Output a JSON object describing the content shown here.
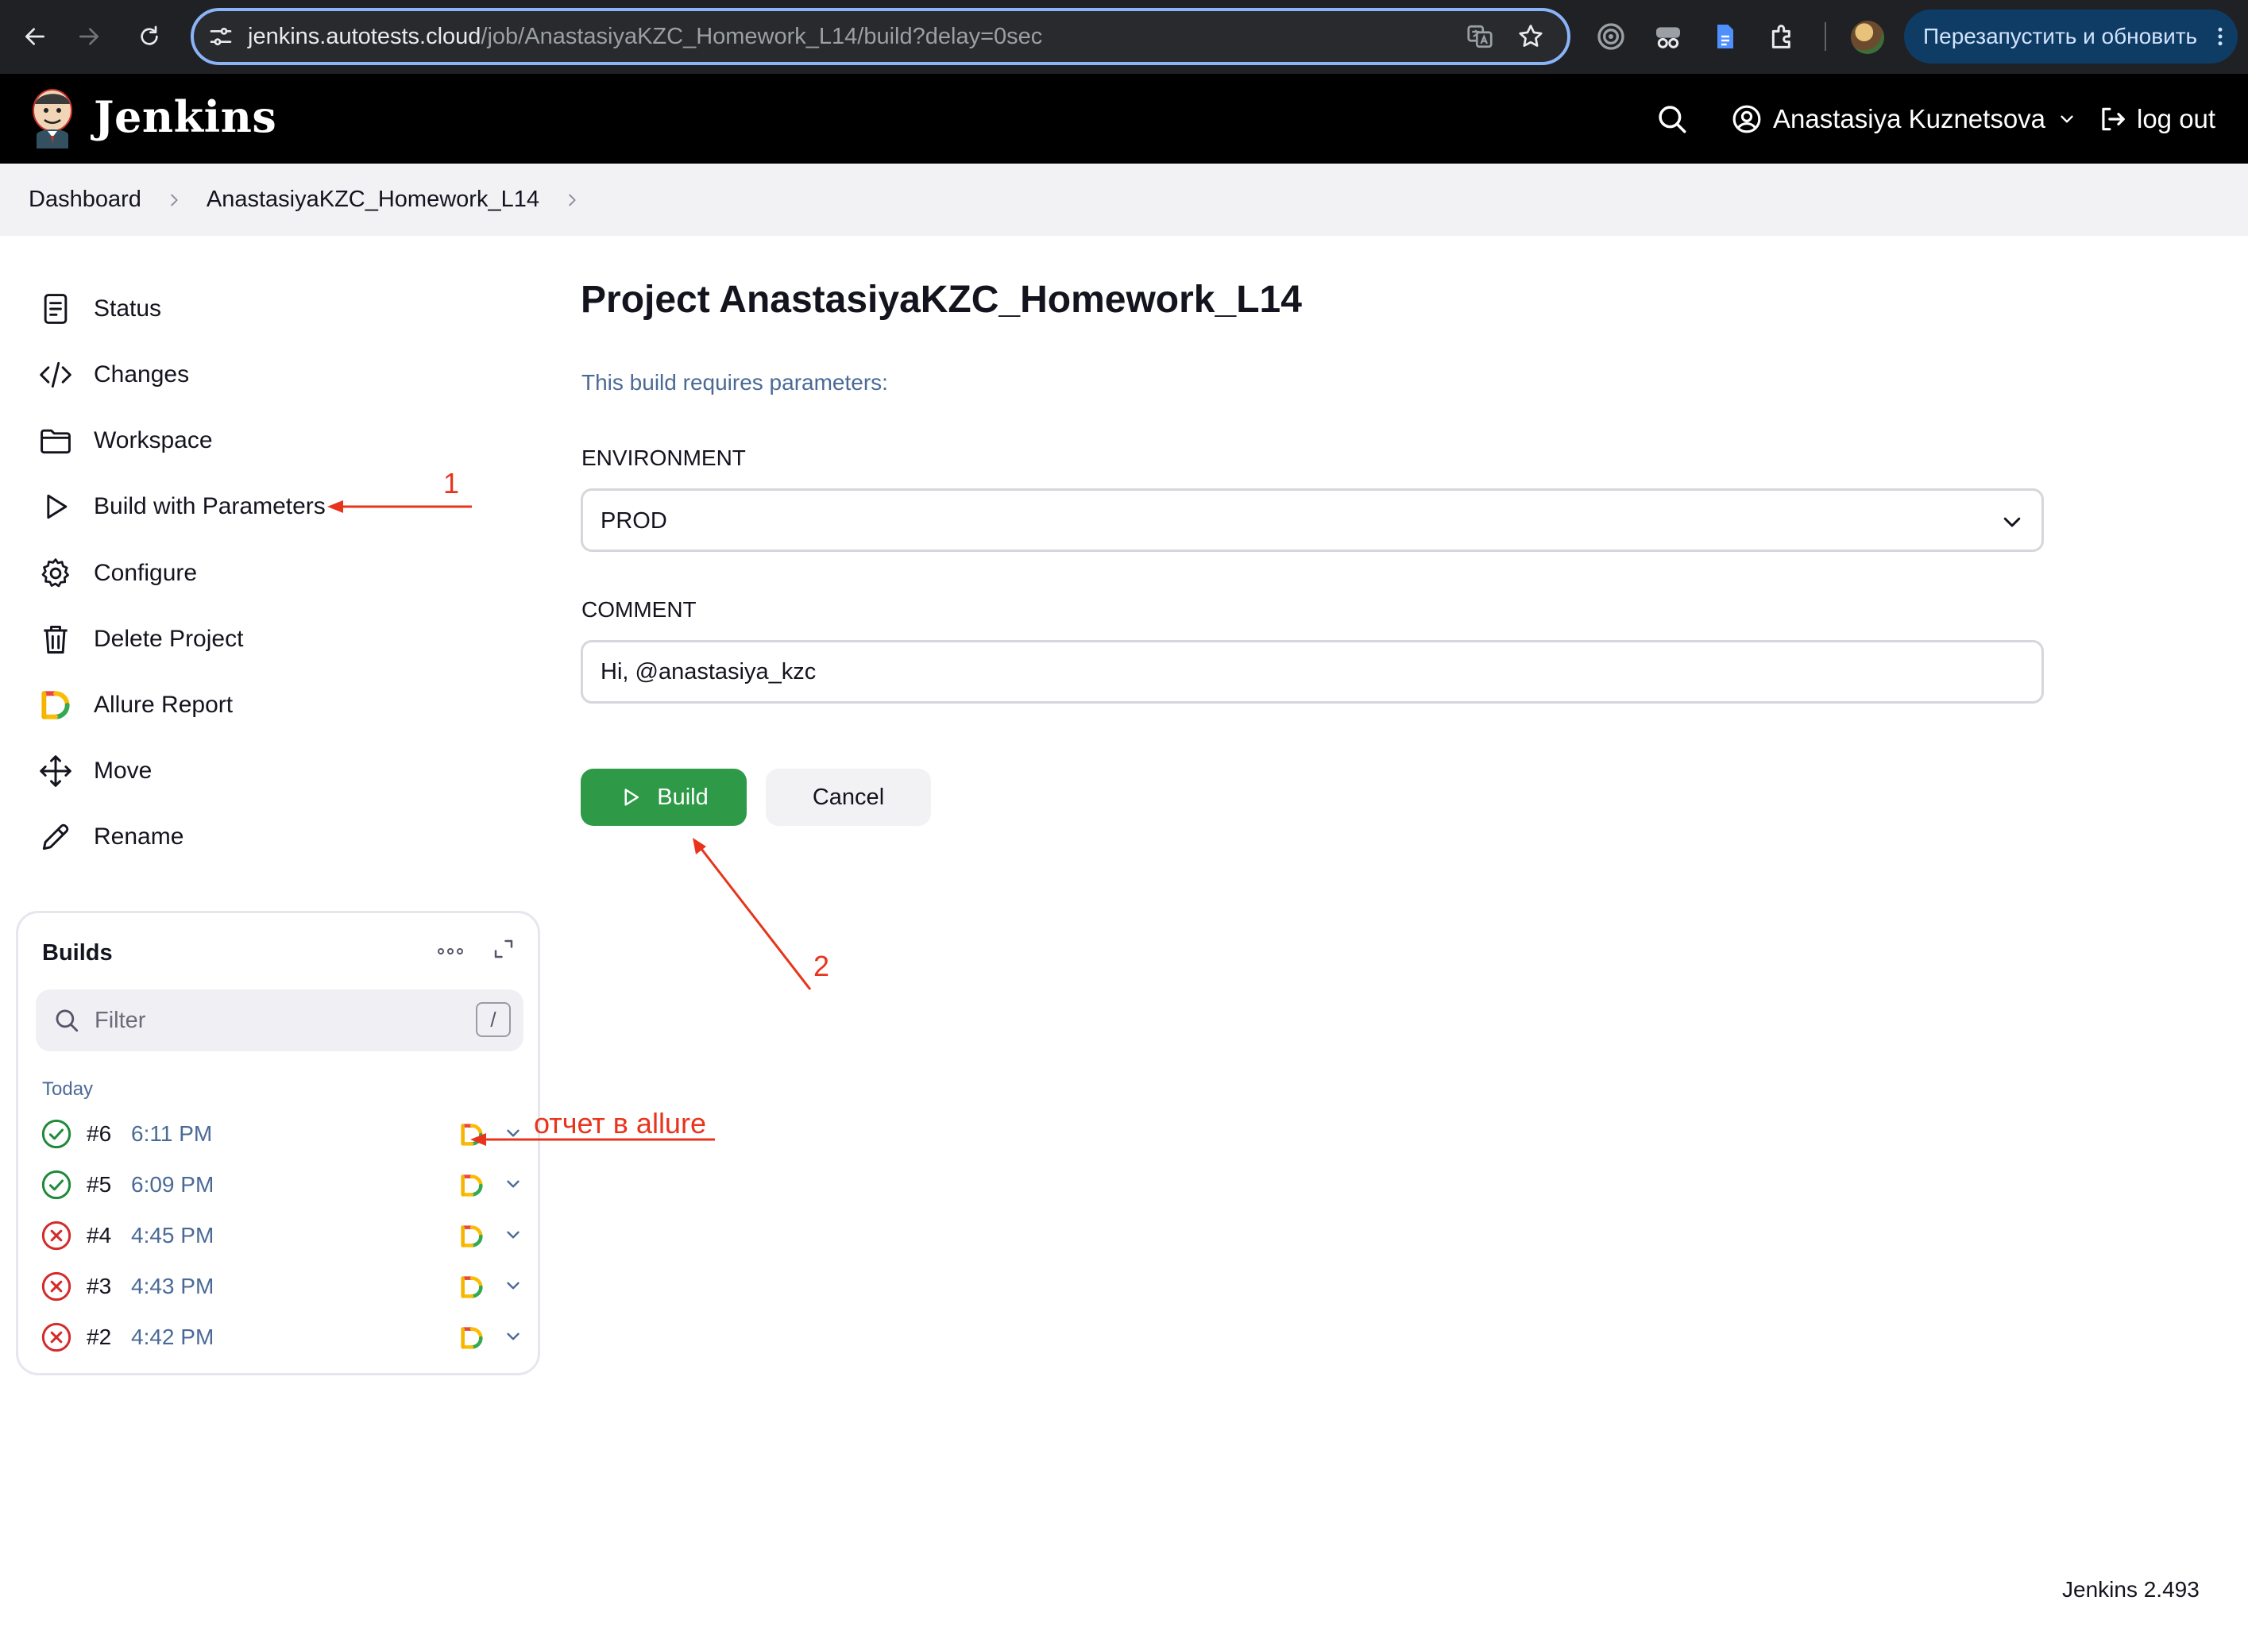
{
  "browser": {
    "url_host": "jenkins.autotests.cloud",
    "url_path": "/job/AnastasiyaKZC_Homework_L14/build?delay=0sec",
    "relaunch_label": "Перезапустить и обновить",
    "icons": [
      "back-icon",
      "forward-icon",
      "reload-icon",
      "site-settings-icon",
      "translate-icon",
      "bookmark-star-icon",
      "extension-icons",
      "profile-avatar"
    ]
  },
  "header": {
    "brand": "Jenkins",
    "user_name": "Anastasiya Kuznetsova",
    "logout_label": "log out"
  },
  "breadcrumb": {
    "items": [
      "Dashboard",
      "AnastasiyaKZC_Homework_L14"
    ]
  },
  "sidebar": {
    "items": [
      {
        "label": "Status",
        "icon": "status-icon"
      },
      {
        "label": "Changes",
        "icon": "code-icon"
      },
      {
        "label": "Workspace",
        "icon": "folder-icon"
      },
      {
        "label": "Build with Parameters",
        "icon": "play-icon"
      },
      {
        "label": "Configure",
        "icon": "gear-icon"
      },
      {
        "label": "Delete Project",
        "icon": "trash-icon"
      },
      {
        "label": "Allure Report",
        "icon": "allure-icon"
      },
      {
        "label": "Move",
        "icon": "move-icon"
      },
      {
        "label": "Rename",
        "icon": "pencil-icon"
      }
    ]
  },
  "builds": {
    "title": "Builds",
    "filter_placeholder": "Filter",
    "filter_shortcut": "/",
    "group_label": "Today",
    "items": [
      {
        "number": "#6",
        "time": "6:11 PM",
        "status": "success"
      },
      {
        "number": "#5",
        "time": "6:09 PM",
        "status": "success"
      },
      {
        "number": "#4",
        "time": "4:45 PM",
        "status": "failed"
      },
      {
        "number": "#3",
        "time": "4:43 PM",
        "status": "failed"
      },
      {
        "number": "#2",
        "time": "4:42 PM",
        "status": "failed"
      }
    ]
  },
  "main": {
    "title": "Project AnastasiyaKZC_Homework_L14",
    "requires_text": "This build requires parameters:",
    "params": {
      "environment_label": "ENVIRONMENT",
      "environment_value": "PROD",
      "comment_label": "COMMENT",
      "comment_value": "Hi, @anastasiya_kzc"
    },
    "build_label": "Build",
    "cancel_label": "Cancel"
  },
  "footer": {
    "version": "Jenkins 2.493"
  },
  "annotations": {
    "label_1": "1",
    "label_2": "2",
    "allure_note": "отчет в allure",
    "color": "#e8341c"
  },
  "colors": {
    "build_button": "#2e9a47",
    "success": "#1f8a3a",
    "failed": "#d42a2a",
    "link_blue": "#4a6a96"
  }
}
